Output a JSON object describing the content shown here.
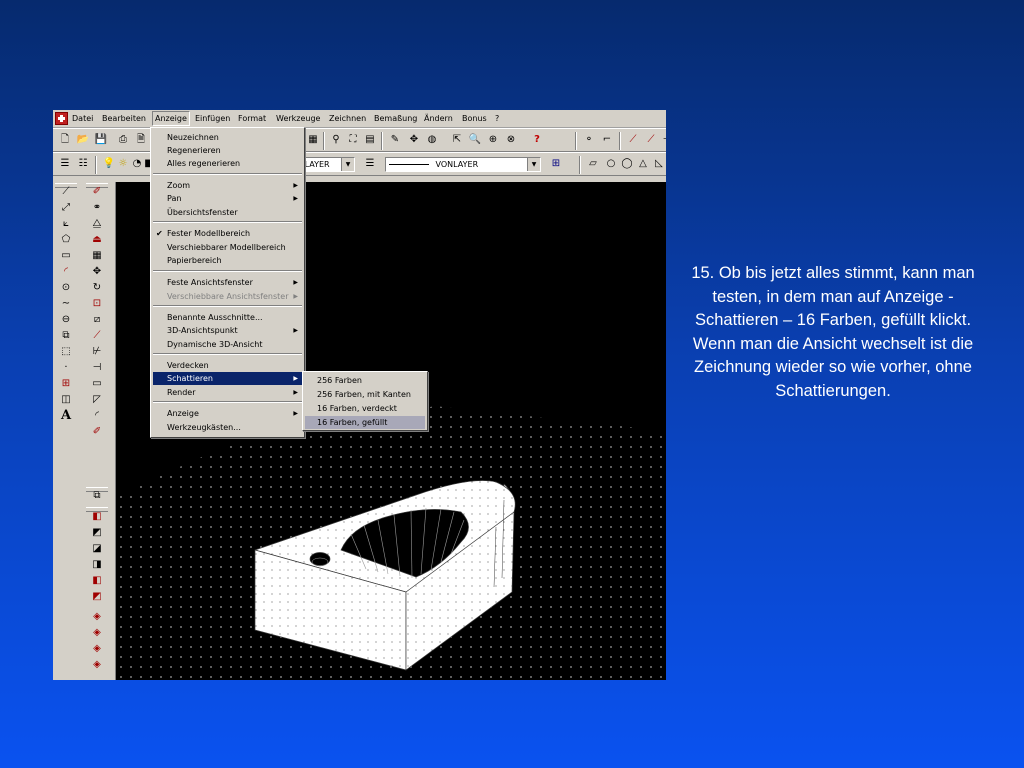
{
  "menubar": {
    "items": [
      "Datei",
      "Bearbeiten",
      "Anzeige",
      "Einfügen",
      "Format",
      "Werkzeuge",
      "Zeichnen",
      "Bemaßung",
      "Ändern",
      "Bonus",
      "?"
    ]
  },
  "toolbar": {
    "layer_combo": "VONLAYER",
    "linetype_combo": "VONLAYER"
  },
  "anzeige_menu": {
    "items": [
      {
        "label": "Neuzeichnen"
      },
      {
        "label": "Regenerieren"
      },
      {
        "label": "Alles regenerieren"
      },
      {
        "label": "Zoom",
        "submenu": true
      },
      {
        "label": "Pan",
        "submenu": true
      },
      {
        "label": "Übersichtsfenster"
      },
      {
        "label": "Fester Modellbereich",
        "checked": true
      },
      {
        "label": "Verschiebbarer Modellbereich"
      },
      {
        "label": "Papierbereich"
      },
      {
        "label": "Feste Ansichtsfenster",
        "submenu": true
      },
      {
        "label": "Verschiebbare Ansichtsfenster",
        "submenu": true,
        "disabled": true
      },
      {
        "label": "Benannte Ausschnitte..."
      },
      {
        "label": "3D-Ansichtspunkt",
        "submenu": true
      },
      {
        "label": "Dynamische 3D-Ansicht"
      },
      {
        "label": "Verdecken"
      },
      {
        "label": "Schattieren",
        "submenu": true,
        "highlighted": true
      },
      {
        "label": "Render",
        "submenu": true
      },
      {
        "label": "Anzeige",
        "submenu": true
      },
      {
        "label": "Werkzeugkästen..."
      }
    ]
  },
  "schattieren_submenu": {
    "items": [
      {
        "label": "256 Farben"
      },
      {
        "label": "256 Farben, mit Kanten"
      },
      {
        "label": "16 Farben, verdeckt"
      },
      {
        "label": "16 Farben, gefüllt",
        "highlighted": true
      }
    ]
  },
  "caption": {
    "text": "15. Ob bis jetzt alles stimmt, kann man testen, in dem man auf Anzeige - Schattieren – 16 Farben, gefüllt klickt. Wenn man die Ansicht wechselt ist die Zeichnung wieder so wie vorher, ohne Schattierungen."
  },
  "colors": {
    "background_top": "#062a6e",
    "background_bottom": "#0a52f0",
    "menu_highlight": "#0a246a",
    "submenu_highlight": "#a8a8b8",
    "canvas": "#000000"
  }
}
